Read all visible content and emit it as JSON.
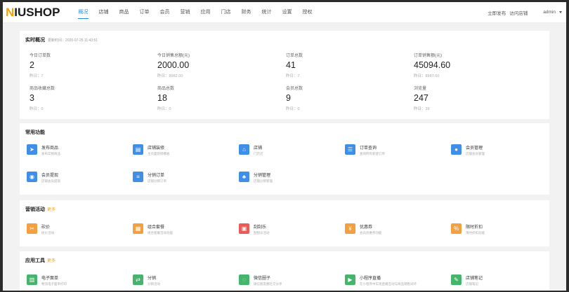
{
  "topbar": {
    "logo_n": "N",
    "logo_rest": "IUSHOP",
    "nav": [
      "概况",
      "店铺",
      "商品",
      "订单",
      "会员",
      "营销",
      "应用",
      "门店",
      "财务",
      "统计",
      "设置",
      "授权"
    ],
    "publish": "立即发布",
    "visit": "访问店铺",
    "user": "admin"
  },
  "overview": {
    "title": "实时概况",
    "update_time": "更新时间：2020-07-25 11:43:51",
    "stats": [
      {
        "label": "今日订单数",
        "value": "2",
        "yesterday": "昨日：7"
      },
      {
        "label": "今日销售总额(元)",
        "value": "2000.00",
        "yesterday": "昨日：8982.00"
      },
      {
        "label": "订单总数",
        "value": "41",
        "yesterday": "昨日：7"
      },
      {
        "label": "订单销售额(元)",
        "value": "45094.60",
        "yesterday": "昨日：8987.60"
      },
      {
        "label": "商品收藏总数",
        "value": "3",
        "yesterday": "昨日：0"
      },
      {
        "label": "商品总数",
        "value": "18",
        "yesterday": "昨日：0"
      },
      {
        "label": "会员总数",
        "value": "9",
        "yesterday": "昨日：0"
      },
      {
        "label": "浏览量",
        "value": "247",
        "yesterday": "昨日：29"
      }
    ]
  },
  "common": {
    "title": "常用功能",
    "items": [
      {
        "title": "发布商品",
        "desc": "发布实物商品",
        "icon": "send-icon",
        "color": "#3f8fe8"
      },
      {
        "title": "店铺装修",
        "desc": "主页面装修模板",
        "icon": "decorate-icon",
        "color": "#3f8fe8"
      },
      {
        "title": "店铺",
        "desc": "门店店",
        "icon": "store-icon",
        "color": "#3f8fe8"
      },
      {
        "title": "订单查询",
        "desc": "查询所有新建订单",
        "icon": "order-search-icon",
        "color": "#3f8fe8"
      },
      {
        "title": "会员管理",
        "desc": "店铺会员管理",
        "icon": "member-icon",
        "color": "#3f8fe8"
      },
      {
        "title": "会员提现",
        "desc": "店铺会员提现",
        "icon": "withdraw-icon",
        "color": "#3f8fe8"
      },
      {
        "title": "分销订单",
        "desc": "店铺分销订单",
        "icon": "list-icon",
        "color": "#3f8fe8"
      },
      {
        "title": "分销管理",
        "desc": "店铺分销管理",
        "icon": "group-icon",
        "color": "#3f8fe8"
      }
    ]
  },
  "marketing": {
    "title": "营销活动",
    "more": "更多",
    "items": [
      {
        "title": "砍价",
        "desc": "砍价活动",
        "icon": "bargain-icon",
        "color": "#f2a040"
      },
      {
        "title": "组合套餐",
        "desc": "组合套餐活动功能",
        "icon": "combo-icon",
        "color": "#f2a040"
      },
      {
        "title": "刮刮乐",
        "desc": "刮刮乐活动",
        "icon": "scratch-icon",
        "color": "#ec5a55"
      },
      {
        "title": "优惠券",
        "desc": "会员优惠券功能",
        "icon": "coupon-icon",
        "color": "#f2a040"
      },
      {
        "title": "限时折扣",
        "desc": "限时折扣功能",
        "icon": "discount-icon",
        "color": "#f2a040"
      }
    ]
  },
  "tools": {
    "title": "应用工具",
    "more": "更多",
    "items": [
      {
        "title": "电子面单",
        "desc": "物流电子面单打印",
        "icon": "waybill-icon",
        "color": "#45b56b"
      },
      {
        "title": "分销",
        "desc": "分销活动",
        "icon": "share-icon",
        "color": "#45b56b"
      },
      {
        "title": "微信圈子",
        "desc": "微信朋友圈社交分享",
        "icon": "circle-icon",
        "color": "#45b56b"
      },
      {
        "title": "小程序直播",
        "desc": "在小程序中实现直播互动与商品销售闭环",
        "icon": "live-icon",
        "color": "#45b56b"
      },
      {
        "title": "店铺笔记",
        "desc": "店铺笔记",
        "icon": "note-icon",
        "color": "#45b56b"
      }
    ]
  }
}
